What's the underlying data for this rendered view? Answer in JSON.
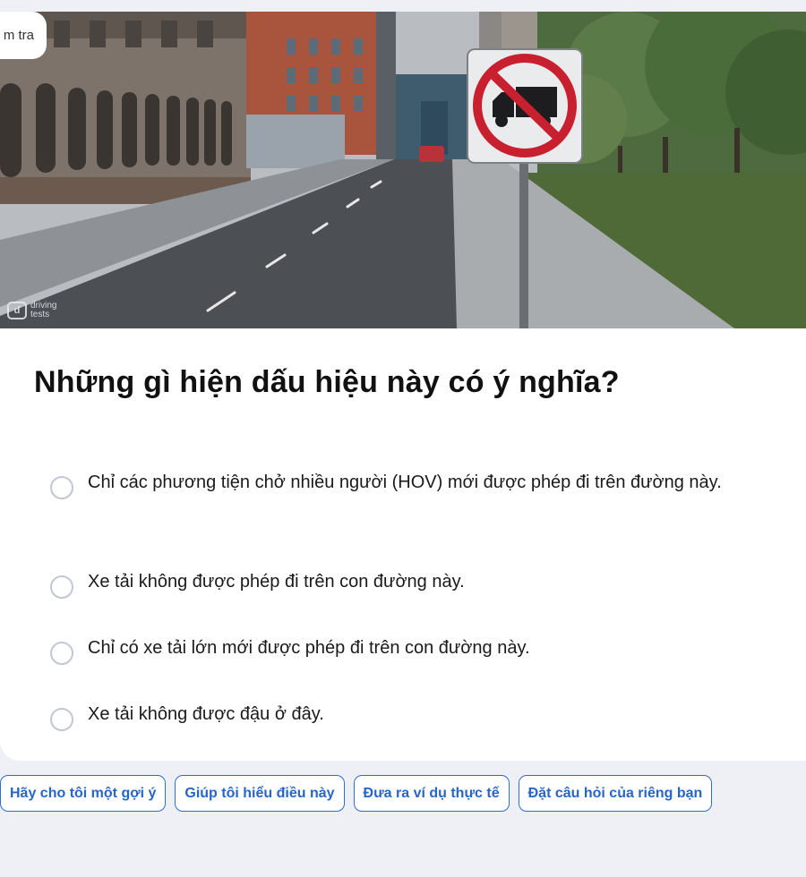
{
  "image": {
    "badge_text": "m tra",
    "watermark_logo": "ɗ",
    "watermark_line1": "driving",
    "watermark_line2": "tests",
    "sign": "no-trucks-sign"
  },
  "question": {
    "title": "Những gì hiện dấu hiệu này có ý nghĩa?",
    "options": [
      "Chỉ các phương tiện chở nhiều người (HOV) mới được phép đi trên đường này.",
      "Xe tải không được phép đi trên con đường này.",
      "Chỉ có xe tải lớn mới được phép đi trên con đường này.",
      "Xe tải không được đậu ở đây."
    ]
  },
  "actions": {
    "hint": "Hãy cho tôi một gợi ý",
    "explain": "Giúp tôi hiểu điều này",
    "example": "Đưa ra ví dụ thực tế",
    "ask": "Đặt câu hỏi của riêng bạn"
  },
  "colors": {
    "accent": "#2766c6",
    "sign_red": "#c8202f",
    "background": "#eef0f5"
  }
}
